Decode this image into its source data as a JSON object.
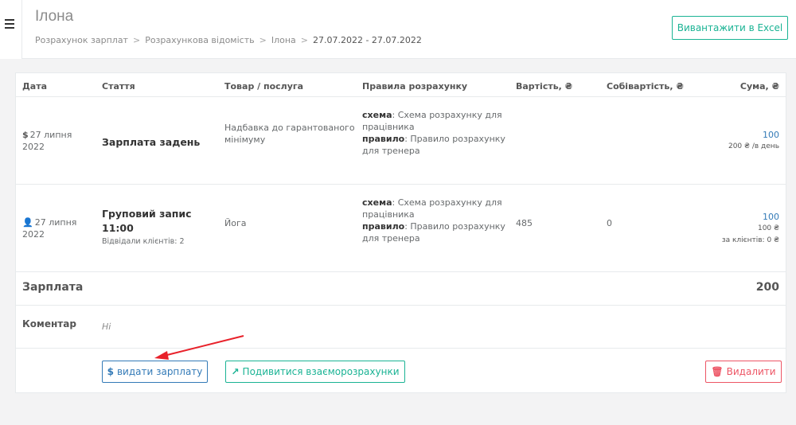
{
  "header": {
    "title": "Ілона",
    "breadcrumb": [
      "Розрахунок зарплат",
      "Розрахункова відомість",
      "Ілона",
      "27.07.2022 - 27.07.2022"
    ],
    "breadcrumb_sep": ">",
    "excel_label": "Вивантажити в Excel"
  },
  "table": {
    "columns": [
      "Дата",
      "Стаття",
      "Товар / послуга",
      "Правила розрахунку",
      "Вартість, ₴",
      "Собівартість, ₴",
      "Сума, ₴"
    ],
    "rows": [
      {
        "icon": "dollar-icon",
        "icon_glyph": "$",
        "date_line1": "27 липня",
        "date_line2": "2022",
        "article": "Зарплата задень",
        "article_line2": "",
        "article_sub": "",
        "product_line1": "Надбавка до гарантованого",
        "product_line2": "мінімуму",
        "scheme_label": "схема",
        "scheme_line1": ": Схема розрахунку для",
        "scheme_line2": "працівника",
        "rule_label": "правило",
        "rule_line1": ": Правило розрахунку",
        "rule_line2": "для тренера",
        "cost": "",
        "prime_cost": "",
        "sum": "100",
        "sum_sub1": "200 ₴ /в день",
        "sum_sub2": ""
      },
      {
        "icon": "user-icon",
        "icon_glyph": "👤",
        "date_line1": "27 липня",
        "date_line2": "2022",
        "article": "Груповий запис",
        "article_line2": "11:00",
        "article_sub": "Відвідали клієнтів: 2",
        "product_line1": "Йога",
        "product_line2": "",
        "scheme_label": "схема",
        "scheme_line1": ": Схема розрахунку для",
        "scheme_line2": "працівника",
        "rule_label": "правило",
        "rule_line1": ": Правило розрахунку",
        "rule_line2": "для тренера",
        "cost": "485",
        "prime_cost": "0",
        "sum": "100",
        "sum_sub1": "100 ₴",
        "sum_sub2": "за клієнтів: 0 ₴"
      }
    ]
  },
  "total": {
    "label": "Зарплата",
    "value": "200"
  },
  "comment": {
    "label": "Коментар",
    "value": "Ні"
  },
  "actions": {
    "pay_glyph": "$",
    "pay_label": "видати зарплату",
    "view_glyph": "↗",
    "view_label": "Подивитися взаєморозрахунки",
    "delete_glyph": "🗑",
    "delete_label": "Видалити"
  },
  "colors": {
    "accent_teal": "#1ab394",
    "primary_blue": "#337ab7",
    "danger_red": "#ed5565",
    "arrow_red": "#e8212a"
  }
}
